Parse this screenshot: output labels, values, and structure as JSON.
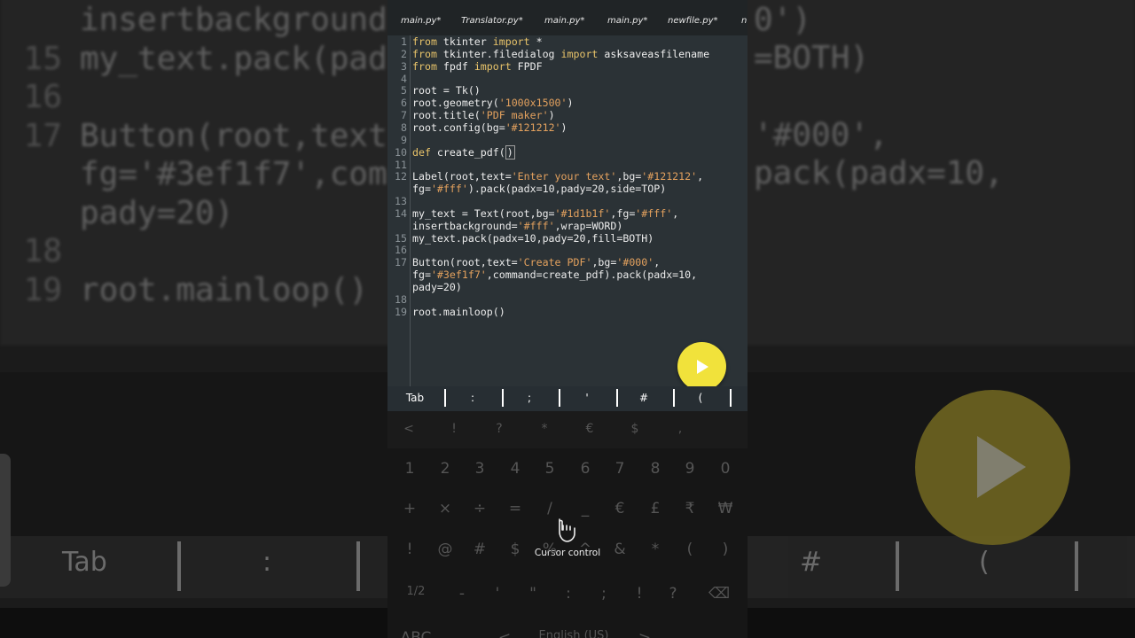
{
  "tabs": [
    "main.py*",
    "Translator.py*",
    "main.py*",
    "main.py*",
    "newfile.py*",
    "n"
  ],
  "code_lines": [
    {
      "num": "1",
      "parts": [
        [
          "kw",
          "from"
        ],
        [
          "t",
          " tkinter "
        ],
        [
          "kw",
          "import"
        ],
        [
          "t",
          " *"
        ]
      ]
    },
    {
      "num": "2",
      "parts": [
        [
          "kw",
          "from"
        ],
        [
          "t",
          " tkinter.filedialog "
        ],
        [
          "kw",
          "import"
        ],
        [
          "t",
          " asksaveasfilename"
        ]
      ]
    },
    {
      "num": "3",
      "parts": [
        [
          "kw",
          "from"
        ],
        [
          "t",
          " fpdf "
        ],
        [
          "kw",
          "import"
        ],
        [
          "t",
          " FPDF"
        ]
      ]
    },
    {
      "num": "4",
      "parts": []
    },
    {
      "num": "5",
      "parts": [
        [
          "t",
          "root = Tk()"
        ]
      ]
    },
    {
      "num": "6",
      "parts": [
        [
          "t",
          "root.geometry("
        ],
        [
          "str",
          "'1000x1500'"
        ],
        [
          "t",
          ")"
        ]
      ]
    },
    {
      "num": "7",
      "parts": [
        [
          "t",
          "root.title("
        ],
        [
          "str",
          "'PDF maker'"
        ],
        [
          "t",
          ")"
        ]
      ]
    },
    {
      "num": "8",
      "parts": [
        [
          "t",
          "root.config(bg="
        ],
        [
          "str",
          "'#121212'"
        ],
        [
          "t",
          ")"
        ]
      ]
    },
    {
      "num": "9",
      "parts": []
    },
    {
      "num": "10",
      "parts": [
        [
          "kw",
          "def"
        ],
        [
          "t",
          " create_pdf("
        ],
        [
          "cur",
          ")"
        ]
      ]
    },
    {
      "num": "11",
      "parts": []
    },
    {
      "num": "12",
      "parts": [
        [
          "t",
          "Label(root,text="
        ],
        [
          "str",
          "'Enter your text'"
        ],
        [
          "t",
          ",bg="
        ],
        [
          "str",
          "'#121212'"
        ],
        [
          "t",
          ","
        ]
      ]
    },
    {
      "num": "",
      "parts": [
        [
          "t",
          "fg="
        ],
        [
          "str",
          "'#fff'"
        ],
        [
          "t",
          ").pack(padx=10,pady=20,side=TOP)"
        ]
      ]
    },
    {
      "num": "13",
      "parts": []
    },
    {
      "num": "14",
      "parts": [
        [
          "t",
          "my_text = Text(root,bg="
        ],
        [
          "str",
          "'#1d1b1f'"
        ],
        [
          "t",
          ",fg="
        ],
        [
          "str",
          "'#fff'"
        ],
        [
          "t",
          ","
        ]
      ]
    },
    {
      "num": "",
      "parts": [
        [
          "t",
          "insertbackground="
        ],
        [
          "str",
          "'#fff'"
        ],
        [
          "t",
          ",wrap=WORD)"
        ]
      ]
    },
    {
      "num": "15",
      "parts": [
        [
          "t",
          "my_text.pack(padx=10,pady=20,fill=BOTH)"
        ]
      ]
    },
    {
      "num": "16",
      "parts": []
    },
    {
      "num": "17",
      "parts": [
        [
          "t",
          "Button(root,text="
        ],
        [
          "str",
          "'Create PDF'"
        ],
        [
          "t",
          ",bg="
        ],
        [
          "str",
          "'#000'"
        ],
        [
          "t",
          ","
        ]
      ]
    },
    {
      "num": "",
      "parts": [
        [
          "t",
          "fg="
        ],
        [
          "str",
          "'#3ef1f7'"
        ],
        [
          "t",
          ",command=create_pdf).pack(padx=10,"
        ]
      ]
    },
    {
      "num": "",
      "parts": [
        [
          "t",
          "pady=20)"
        ]
      ]
    },
    {
      "num": "18",
      "parts": []
    },
    {
      "num": "19",
      "parts": [
        [
          "t",
          "root.mainloop()"
        ]
      ]
    }
  ],
  "symbols": [
    "Tab",
    ":",
    ";",
    "'",
    "#",
    "("
  ],
  "keyboard": {
    "row0": [
      "<",
      "!",
      "?",
      "*",
      "€",
      "$",
      ","
    ],
    "row1": [
      "1",
      "2",
      "3",
      "4",
      "5",
      "6",
      "7",
      "8",
      "9",
      "0"
    ],
    "row2": [
      "+",
      "×",
      "÷",
      "=",
      "/",
      "_",
      "€",
      "£",
      "₹",
      "₩"
    ],
    "row3": [
      "!",
      "@",
      "#",
      "$",
      "%",
      "^",
      "&",
      "*",
      "(",
      ")"
    ],
    "row4": [
      "1/2",
      "-",
      "'",
      "\"",
      ":",
      ";",
      "!",
      "?",
      "⌫"
    ],
    "row5": [
      "ABC",
      ",",
      "<",
      "English (US)",
      ">",
      "."
    ]
  },
  "cursor_control_label": "Cursor control",
  "background": {
    "lines": [
      {
        "num": "",
        "text": "insertbackground"
      },
      {
        "num": "15",
        "text": "my_text.pack(pad"
      },
      {
        "num": "16",
        "text": ""
      },
      {
        "num": "17",
        "text": "Button(root,text"
      },
      {
        "num": "",
        "text": "fg='#3ef1f7',com"
      },
      {
        "num": "",
        "text": "pady=20)"
      },
      {
        "num": "18",
        "text": ""
      },
      {
        "num": "19",
        "text": "root.mainloop()"
      }
    ],
    "right_lines": [
      "0')",
      "=BOTH)",
      "'#000',",
      "pack(padx=10,"
    ],
    "bar": [
      "Tab",
      ":",
      "#",
      "("
    ]
  },
  "colors": {
    "accent": "#f1e23b",
    "keyword": "#e9c46a",
    "string": "#e3a15e"
  }
}
